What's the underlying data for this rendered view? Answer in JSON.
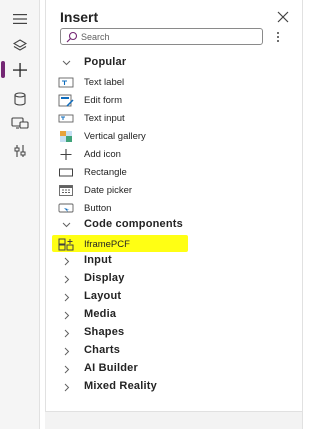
{
  "pane": {
    "title": "Insert",
    "search_placeholder": "Search"
  },
  "rail": {
    "items": [
      "hamburger-icon",
      "layers-icon",
      "plus-icon",
      "database-icon",
      "media-icon",
      "tools-icon"
    ],
    "accent_color": "#742774"
  },
  "sections": {
    "popular": "Popular",
    "code_components": "Code components",
    "input": "Input",
    "display": "Display",
    "layout": "Layout",
    "media": "Media",
    "shapes": "Shapes",
    "charts": "Charts",
    "ai_builder": "AI Builder",
    "mixed_reality": "Mixed Reality"
  },
  "popular_items": {
    "text_label": "Text label",
    "edit_form": "Edit form",
    "text_input": "Text input",
    "vertical_gallery": "Vertical gallery",
    "add_icon": "Add icon",
    "rectangle": "Rectangle",
    "date_picker": "Date picker",
    "button": "Button"
  },
  "code_component_items": {
    "iframepcf": "IframePCF"
  },
  "highlight_color": "#ffff14"
}
